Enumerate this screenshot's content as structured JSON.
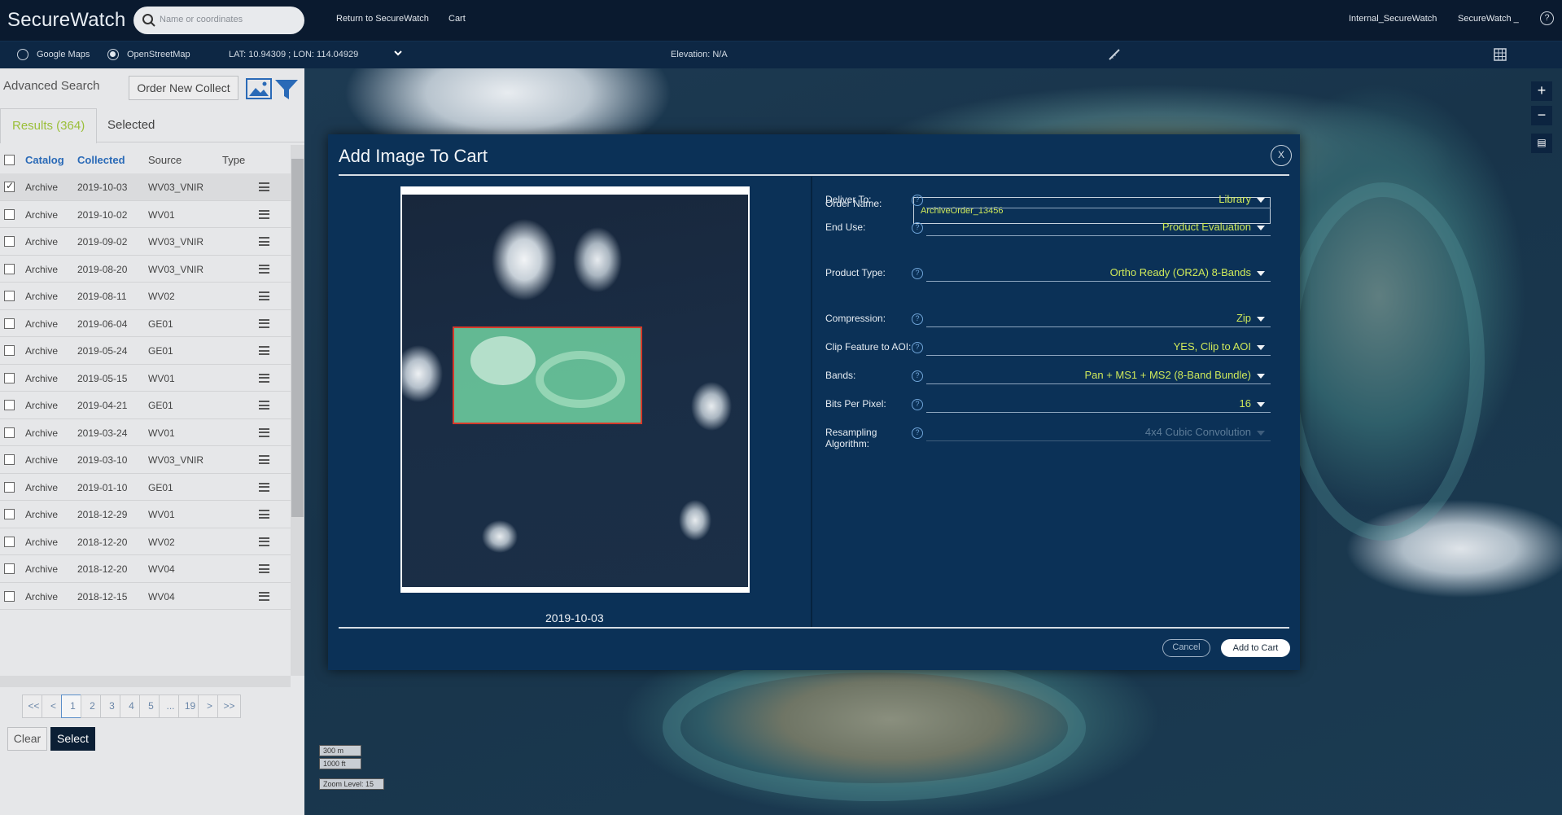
{
  "app": {
    "title": "SecureWatch"
  },
  "search": {
    "placeholder": "Name or coordinates"
  },
  "topnav": {
    "return_link": "Return to SecureWatch",
    "cart_link": "Cart",
    "account1": "Internal_SecureWatch",
    "account2": "SecureWatch _",
    "help": "?"
  },
  "subbar": {
    "basemap_google": "Google Maps",
    "basemap_osm": "OpenStreetMap",
    "basemap_selected": "OpenStreetMap",
    "coords": "LAT: 10.94309 ; LON: 114.04929",
    "elevation": "Elevation: N/A"
  },
  "panel": {
    "advanced_search": "Advanced Search",
    "order_new_collect": "Order New Collect",
    "tab_results": "Results (364)",
    "tab_selected": "Selected",
    "columns": [
      "Catalog",
      "Collected",
      "Source",
      "Type"
    ],
    "rows": [
      {
        "catalog": "Archive",
        "collected": "2019-10-03",
        "source": "WV03_VNIR",
        "checked": true
      },
      {
        "catalog": "Archive",
        "collected": "2019-10-02",
        "source": "WV01",
        "checked": false
      },
      {
        "catalog": "Archive",
        "collected": "2019-09-02",
        "source": "WV03_VNIR",
        "checked": false
      },
      {
        "catalog": "Archive",
        "collected": "2019-08-20",
        "source": "WV03_VNIR",
        "checked": false
      },
      {
        "catalog": "Archive",
        "collected": "2019-08-11",
        "source": "WV02",
        "checked": false
      },
      {
        "catalog": "Archive",
        "collected": "2019-06-04",
        "source": "GE01",
        "checked": false
      },
      {
        "catalog": "Archive",
        "collected": "2019-05-24",
        "source": "GE01",
        "checked": false
      },
      {
        "catalog": "Archive",
        "collected": "2019-05-15",
        "source": "WV01",
        "checked": false
      },
      {
        "catalog": "Archive",
        "collected": "2019-04-21",
        "source": "GE01",
        "checked": false
      },
      {
        "catalog": "Archive",
        "collected": "2019-03-24",
        "source": "WV01",
        "checked": false
      },
      {
        "catalog": "Archive",
        "collected": "2019-03-10",
        "source": "WV03_VNIR",
        "checked": false
      },
      {
        "catalog": "Archive",
        "collected": "2019-01-10",
        "source": "GE01",
        "checked": false
      },
      {
        "catalog": "Archive",
        "collected": "2018-12-29",
        "source": "WV01",
        "checked": false
      },
      {
        "catalog": "Archive",
        "collected": "2018-12-20",
        "source": "WV02",
        "checked": false
      },
      {
        "catalog": "Archive",
        "collected": "2018-12-20",
        "source": "WV04",
        "checked": false
      },
      {
        "catalog": "Archive",
        "collected": "2018-12-15",
        "source": "WV04",
        "checked": false
      }
    ],
    "pager": [
      "<<",
      "<",
      "1",
      "2",
      "3",
      "4",
      "5",
      "...",
      "19",
      ">",
      ">>"
    ],
    "current_page": "1",
    "clear": "Clear",
    "select": "Select"
  },
  "map": {
    "scale_m": "300 m",
    "scale_ft": "1000 ft",
    "zoom_level": "Zoom Level: 15",
    "zoom_in": "+",
    "zoom_out": "−"
  },
  "modal": {
    "title": "Add Image To Cart",
    "close": "X",
    "preview_date": "2019-10-03",
    "order_name_label": "Order Name:",
    "order_name_value": "ArchiveOrder_13456",
    "fields": [
      {
        "label": "Deliver To:",
        "value": "Library",
        "dim": false
      },
      {
        "label": "End Use:",
        "value": "Product Evaluation",
        "dim": false
      },
      {
        "label": "Product Type:",
        "value": "Ortho Ready (OR2A) 8-Bands",
        "dim": false
      },
      {
        "label": "Compression:",
        "value": "Zip",
        "dim": false
      },
      {
        "label": "Clip Feature to AOI:",
        "value": "YES, Clip to AOI",
        "dim": false
      },
      {
        "label": "Bands:",
        "value": "Pan + MS1 + MS2 (8-Band Bundle)",
        "dim": false
      },
      {
        "label": "Bits Per Pixel:",
        "value": "16",
        "dim": false
      },
      {
        "label": "Resampling Algorithm:",
        "value": "4x4 Cubic Convolution",
        "dim": true
      }
    ],
    "cancel": "Cancel",
    "add_to_cart": "Add to Cart"
  },
  "colors": {
    "accent_value": "#cfe95a",
    "results_tab": "#9bbf3a",
    "header_bg": "#0a1a2f",
    "modal_bg": "#0b3157"
  }
}
